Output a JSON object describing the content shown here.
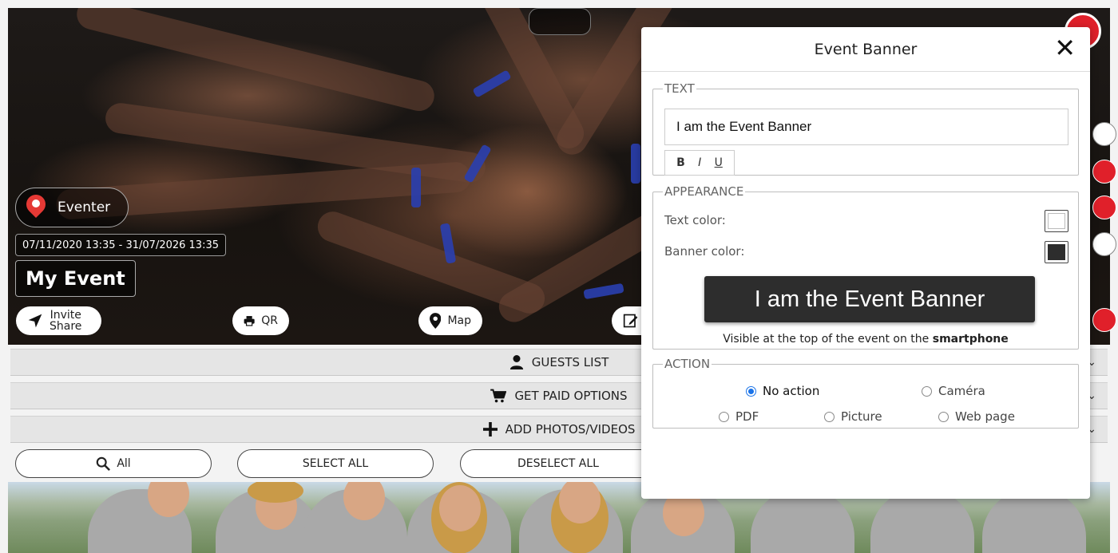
{
  "hero": {
    "organizer": "Eventer",
    "dates": "07/11/2020 13:35 - 31/07/2026 13:35",
    "event_title": "My Event",
    "buttons": {
      "invite_line1": "Invite",
      "invite_line2": "Share",
      "qr": "QR",
      "map": "Map"
    }
  },
  "sections": {
    "guests_list": "GUESTS LIST",
    "paid_options": "GET PAID OPTIONS",
    "add_media": "ADD PHOTOS/VIDEOS"
  },
  "actions": {
    "all": "All",
    "select_all": "SELECT ALL",
    "deselect_all": "DESELECT ALL"
  },
  "modal": {
    "title": "Event Banner",
    "text_section": {
      "legend": "TEXT",
      "value": "I am the Event Banner",
      "bold": "B",
      "italic": "I",
      "underline": "U"
    },
    "appearance": {
      "legend": "APPEARANCE",
      "text_color_label": "Text color:",
      "banner_color_label": "Banner color:",
      "text_color": "#ffffff",
      "banner_color": "#2d2d2d",
      "preview_text": "I am the Event Banner",
      "note_prefix": "Visible at the top of the event on the",
      "note_bold": "smartphone"
    },
    "action": {
      "legend": "ACTION",
      "options": {
        "no_action": "No action",
        "camera": "Caméra",
        "pdf": "PDF",
        "picture": "Picture",
        "web_page": "Web page"
      },
      "selected": "No action"
    }
  },
  "colors": {
    "accent_red": "#e53935",
    "radio_blue": "#1a73e8"
  }
}
